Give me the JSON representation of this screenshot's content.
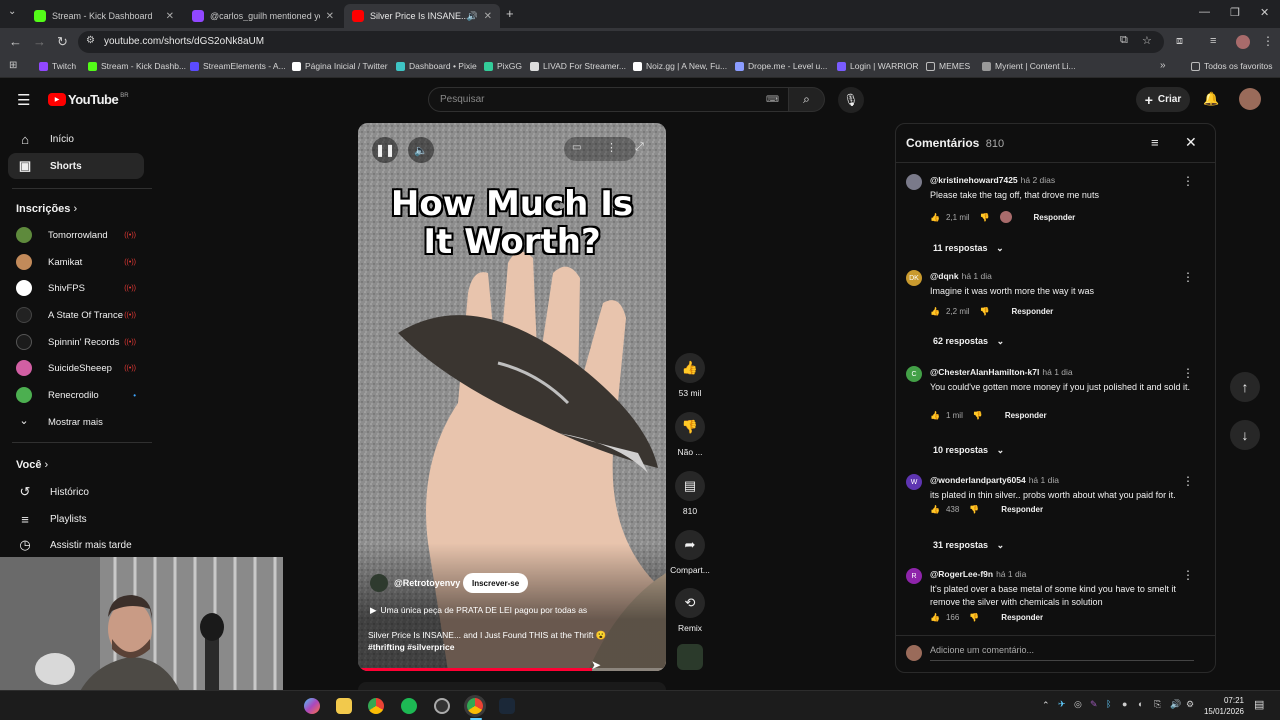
{
  "browser": {
    "tabs": [
      {
        "title": "Stream - Kick Dashboard",
        "color": "#53fc18"
      },
      {
        "title": "@carlos_guilh mentioned yo",
        "color": "#9147ff"
      },
      {
        "title": "Silver Price Is INSANE... and",
        "color": "#ff0000"
      }
    ],
    "url": "youtube.com/shorts/dGS2oNk8aUM",
    "bookmarks": [
      {
        "label": "Twitch",
        "color": "#9147ff"
      },
      {
        "label": "Stream - Kick Dashb...",
        "color": "#53fc18"
      },
      {
        "label": "StreamElements - A...",
        "color": "#5b4bff"
      },
      {
        "label": "Página Inicial / Twitter",
        "color": "#ffffff"
      },
      {
        "label": "Dashboard • Pixie",
        "color": "#3ec4c4"
      },
      {
        "label": "PixGG",
        "color": "#33cc99"
      },
      {
        "label": "LIVAD For Streamer...",
        "color": "#dddddd"
      },
      {
        "label": "Noiz.gg | A New, Fu...",
        "color": "#ffffff"
      },
      {
        "label": "Drope.me - Level u...",
        "color": "#8b9cff"
      },
      {
        "label": "Login | WARRIOR",
        "color": "#7a5cff"
      },
      {
        "label": "MEMES",
        "color": "#bbbbbb"
      },
      {
        "label": "Myrient | Content Li...",
        "color": "#999999"
      }
    ],
    "all_bookmarks": "Todos os favoritos"
  },
  "youtube": {
    "logo_text": "YouTube",
    "logo_region": "BR",
    "search_placeholder": "Pesquisar",
    "create_label": "Criar",
    "sidebar": {
      "home": "Início",
      "shorts": "Shorts",
      "subscriptions_title": "Inscrições",
      "subscriptions": [
        {
          "name": "Tomorrowland",
          "color": "#5e8a3c",
          "live": true
        },
        {
          "name": "Kamikat",
          "color": "#c28a5a",
          "live": true
        },
        {
          "name": "ShivFPS",
          "color": "#ffffff",
          "live": true
        },
        {
          "name": "A State Of Trance",
          "color": "#222222",
          "live": true
        },
        {
          "name": "Spinnin' Records",
          "color": "#1b1b1b",
          "live": true
        },
        {
          "name": "SuicideSheeep",
          "color": "#d15fa3",
          "live": true
        },
        {
          "name": "Renecrodilo",
          "color": "#4caf50",
          "live": false
        }
      ],
      "show_more": "Mostrar mais",
      "you_title": "Você",
      "history": "Histórico",
      "playlists": "Playlists",
      "watch_later": "Assistir mais tarde"
    },
    "video": {
      "overlay_title": "How Much Is It Worth?",
      "channel": "@Retrotoyenvy",
      "subscribe": "Inscrever-se",
      "featured": "Uma única peça de PRATA DE LEI pagou por todas as",
      "caption": "Silver Price Is INSANE... and I Just Found THIS at the Thrift 😮",
      "hashtags": "#thrifting #silverprice",
      "progress": 0.76
    },
    "actions": {
      "likes": "53 mil",
      "dislike": "Não ...",
      "comments": "810",
      "share": "Compart...",
      "remix": "Remix"
    },
    "comments": {
      "title": "Comentários",
      "count": "810",
      "add_placeholder": "Adicione um comentário...",
      "items": [
        {
          "author": "@kristinehoward7425",
          "time": "há 2 dias",
          "text": "Please take the tag off, that drove me nuts",
          "likes": "2,1 mil",
          "reply": "Responder",
          "replies": "11 respostas",
          "avatar_color": "#7a7a8a",
          "initial": ""
        },
        {
          "author": "@dqnk",
          "time": "há 1 dia",
          "text": "Imagine it was worth more the way it was",
          "likes": "2,2 mil",
          "reply": "Responder",
          "replies": "62 respostas",
          "avatar_color": "#c99a2e",
          "initial": "DK"
        },
        {
          "author": "@ChesterAlanHamilton-k7l",
          "time": "há 1 dia",
          "text": "You could've gotten more money if you just polished it and sold it.",
          "likes": "1 mil",
          "reply": "Responder",
          "replies": "10 respostas",
          "avatar_color": "#43a047",
          "initial": "C"
        },
        {
          "author": "@wonderlandparty6054",
          "time": "há 1 dia",
          "text": "its plated in thin silver.. probs worth about what you paid for it.",
          "likes": "438",
          "reply": "Responder",
          "replies": "31 respostas",
          "avatar_color": "#5e35b1",
          "initial": "W"
        },
        {
          "author": "@RogerLee-f9n",
          "time": "há 1 dia",
          "text": "It's plated over a base metal of some kind you have to smelt it remove the silver with chemicals in solution",
          "likes": "166",
          "reply": "Responder",
          "replies": "",
          "avatar_color": "#8e24aa",
          "initial": "R"
        }
      ]
    }
  },
  "taskbar": {
    "time": "07:21",
    "date": "15/01/2026"
  }
}
